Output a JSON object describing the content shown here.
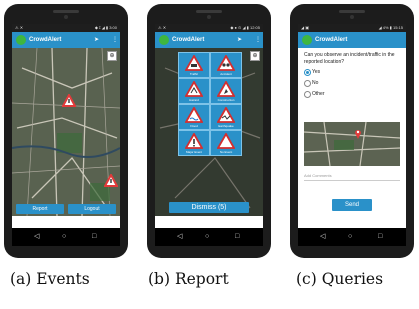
{
  "app": {
    "title": "CrowdAlert"
  },
  "phones": [
    {
      "status_left": "⚠ ✕",
      "status_right": "◆ ⟟ ◢ ▮ 3:00",
      "buttons": {
        "report": "Report",
        "logout": "Logout"
      }
    },
    {
      "status_left": "⚠ ✕",
      "status_right": "◆ ● ⊙ ◢ ▮ 12:05",
      "tiles": [
        "Traffic",
        "Accident",
        "Hazard",
        "Construction",
        "Flood",
        "Earthquake",
        "Major Event",
        "No Event"
      ],
      "dismiss": "Dismiss (5)"
    },
    {
      "status_left": "◢ ▣",
      "status_right": "◢ 4% ▮ 15:15",
      "question": "Can you observe an incident/traffic in the reported location?",
      "options": [
        "Yes",
        "No",
        "Other"
      ],
      "selected_option": "Yes",
      "comments_placeholder": "Add Comments",
      "send": "Send"
    }
  ],
  "captions": [
    "(a) Events",
    "(b) Report",
    "(c) Queries"
  ],
  "colors": {
    "appbar": "#2a91c9",
    "alert_marker": "#e23a3a"
  }
}
